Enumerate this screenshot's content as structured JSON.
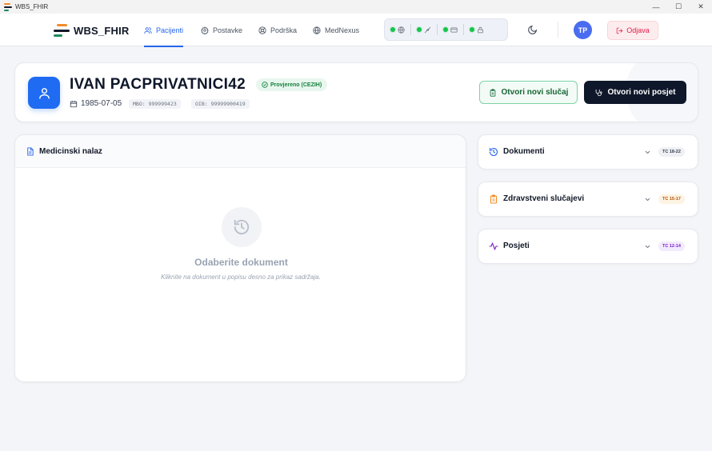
{
  "window": {
    "title": "WBS_FHIR",
    "controls": {
      "minimize": "—",
      "maximize": "☐",
      "close": "✕"
    }
  },
  "navbar": {
    "brand": "WBS_FHIR",
    "items": [
      {
        "label": "Pacijenti",
        "icon": "users-icon",
        "active": true
      },
      {
        "label": "Postavke",
        "icon": "gear-icon",
        "active": false
      },
      {
        "label": "Podrška",
        "icon": "lifebuoy-icon",
        "active": false
      },
      {
        "label": "MedNexus",
        "icon": "globe-icon",
        "active": false
      }
    ],
    "status_indicators": [
      {
        "icon": "globe-icon",
        "state": "online"
      },
      {
        "icon": "activity-icon",
        "state": "online"
      },
      {
        "icon": "card-icon",
        "state": "online"
      },
      {
        "icon": "lock-icon",
        "state": "online"
      }
    ],
    "user_initials": "TP",
    "logout_label": "Odjava"
  },
  "patient": {
    "name": "IVAN PACPRIVATNICI42",
    "verified_label": "Provjereno (CEZIH)",
    "dob": "1985-07-05",
    "mbo": "MBO: 999999423",
    "oib": "OIB: 99999900419",
    "actions": {
      "new_case": "Otvori novi slučaj",
      "new_visit": "Otvori novi posjet"
    }
  },
  "report": {
    "title": "Medicinski nalaz",
    "empty_title": "Odaberite dokument",
    "empty_text": "Kliknite na dokument u popisu desno za prikaz sadržaja."
  },
  "panels": [
    {
      "title": "Dokumenti",
      "tag": "TC 18-22",
      "icon": "history-icon",
      "tag_bg": "#eef0f4",
      "tag_color": "#374151"
    },
    {
      "title": "Zdravstveni slučajevi",
      "tag": "TC 15-17",
      "icon": "clipboard-icon",
      "tag_bg": "#fdf3e3",
      "tag_color": "#b45309"
    },
    {
      "title": "Posjeti",
      "tag": "TC 12-14",
      "icon": "activity-icon",
      "tag_bg": "#f2eafd",
      "tag_color": "#7e22ce"
    }
  ],
  "colors": {
    "accent": "#2563eb",
    "brand_orange": "#f28c28",
    "brand_green": "#1f8a5c",
    "success": "#16c44a",
    "danger": "#e11d48",
    "dark": "#0f172a"
  }
}
